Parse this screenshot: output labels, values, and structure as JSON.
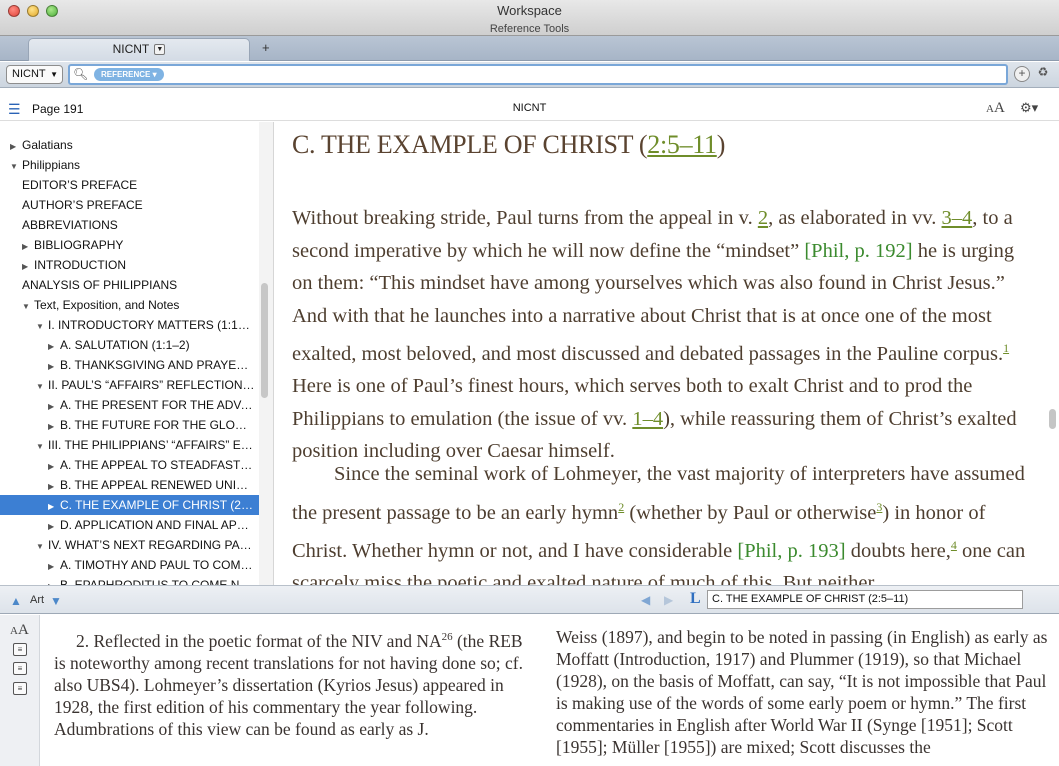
{
  "window": {
    "title": "Workspace",
    "subtitle": "Reference Tools"
  },
  "tabs": {
    "active_label": "NICNT",
    "add_symbol": "+"
  },
  "toolbar": {
    "resource": "NICNT",
    "search_pill": "REFERENCE",
    "search_value": ""
  },
  "panel": {
    "page_label": "Page 191",
    "title": "NICNT",
    "font_small": "A",
    "font_large": "A"
  },
  "toc": [
    {
      "label": "Galatians",
      "tri": "▶"
    },
    {
      "label": "Philippians",
      "tri": "▼"
    },
    {
      "label": "EDITOR’S PREFACE",
      "tri": ""
    },
    {
      "label": "AUTHOR’S PREFACE",
      "tri": ""
    },
    {
      "label": "ABBREVIATIONS",
      "tri": ""
    },
    {
      "label": "BIBLIOGRAPHY",
      "tri": "▶"
    },
    {
      "label": "INTRODUCTION",
      "tri": "▶"
    },
    {
      "label": "ANALYSIS OF PHILIPPIANS",
      "tri": ""
    },
    {
      "label": "Text, Exposition, and Notes",
      "tri": "▼"
    },
    {
      "label": "I. INTRODUCTORY MATTERS (1:1–11)",
      "tri": "▼"
    },
    {
      "label": "A. SALUTATION (1:1–2)",
      "tri": "▶"
    },
    {
      "label": "B. THANKSGIVING AND PRAYER…",
      "tri": "▶"
    },
    {
      "label": "II. PAUL’S “AFFAIRS” REFLECTION…",
      "tri": "▼"
    },
    {
      "label": "A. THE PRESENT FOR THE ADVA…",
      "tri": "▶"
    },
    {
      "label": "B. THE FUTURE FOR THE GLOR…",
      "tri": "▶"
    },
    {
      "label": "III. THE PHILIPPIANS’ “AFFAIRS” E…",
      "tri": "▼"
    },
    {
      "label": "A. THE APPEAL TO STEADFAST…",
      "tri": "▶"
    },
    {
      "label": "B. THE APPEAL RENEWED UNIT…",
      "tri": "▶"
    },
    {
      "label": "C. THE EXAMPLE OF CHRIST (2:…",
      "tri": "▶"
    },
    {
      "label": "D. APPLICATION AND FINAL APP…",
      "tri": "▶"
    },
    {
      "label": "IV. WHAT’S NEXT REGARDING PA…",
      "tri": "▼"
    },
    {
      "label": "A. TIMOTHY AND PAUL TO COM…",
      "tri": "▶"
    },
    {
      "label": "B. EPAPHRODITUS TO COME N…",
      "tri": "▶"
    }
  ],
  "content": {
    "heading_text": "C. THE EXAMPLE OF CHRIST (",
    "heading_ref": "2:5–11",
    "heading_close": ")",
    "p1": {
      "a": "Without breaking stride, Paul turns from the appeal in v. ",
      "ref1": "2",
      "b": ", as elaborated in vv. ",
      "ref2": "3–4",
      "c": ", to a second imperative by which he will now define the “mindset” ",
      "xref1": "[Phil, p. 192]",
      "d": " he is urging on them: “This mindset have among yourselves which was also found in Christ Jesus.” And with that he launches into a narrative about Christ that is at once one of the most exalted, most beloved, and most discussed and debated passages in the Pauline corpus.",
      "fn1": "1",
      "e": " Here is one of Paul’s finest hours, which serves both to exalt Christ and to prod the Philippians to emulation (the issue of vv. ",
      "ref3": "1–4",
      "f": "), while reassuring them of Christ’s exalted position including over Caesar himself."
    },
    "p2": {
      "a": "Since the seminal work of Lohmeyer, the vast majority of interpreters have assumed the present passage to be an early hymn",
      "fn2": "2",
      "b": " (whether by Paul or otherwise",
      "fn3": "3",
      "c": ") in honor of Christ. Whether hymn or not, and I have considerable ",
      "xref2": "[Phil, p. 193]",
      "d": " doubts here,",
      "fn4": "4",
      "e": " one can scarcely miss the poetic and exalted nature of much of this. But neither,"
    }
  },
  "navbar": {
    "art_label": "Art",
    "location": "C. THE EXAMPLE OF CHRIST (2:5–11)",
    "L": "L"
  },
  "footnote": {
    "left_a": "2. Reflected in the poetic format of the NIV and NA",
    "left_sup": "26",
    "left_b": " (the REB is noteworthy among recent translations for not having done so; cf. also UBS4). Lohmeyer’s dissertation (Kyrios Jesus) appeared in 1928, the first edition of his commentary the year following. Adumbrations of this view can be found as early as J.",
    "right": "Weiss (1897), and begin to be noted in passing (in English) as early as Moffatt (Introduction, 1917) and Plummer (1919), so that Michael (1928), on the basis of Moffatt, can say, “It is not impossible that Paul is making use of the words of some early poem or hymn.” The first commentaries in English after World War II (Synge [1951]; Scott [1955]; Müller [1955]) are mixed; Scott discusses the"
  }
}
